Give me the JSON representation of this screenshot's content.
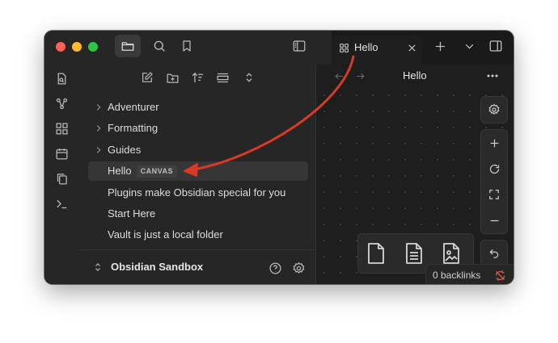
{
  "window": {
    "traffic_lights": {
      "close": "#ff5f57",
      "minimize": "#febc2e",
      "maximize": "#28c840"
    }
  },
  "tab": {
    "label": "Hello"
  },
  "view_header": {
    "title": "Hello"
  },
  "file_tree": {
    "folders": [
      {
        "label": "Adventurer"
      },
      {
        "label": "Formatting"
      },
      {
        "label": "Guides"
      }
    ],
    "active_file": {
      "label": "Hello",
      "badge": "CANVAS"
    },
    "files": [
      {
        "label": "Plugins make Obsidian special for you"
      },
      {
        "label": "Start Here"
      },
      {
        "label": "Vault is just a local folder"
      }
    ]
  },
  "vault": {
    "name": "Obsidian Sandbox"
  },
  "status_bar": {
    "backlinks": "0 backlinks"
  },
  "colors": {
    "annotation_arrow": "#d93a26",
    "accent": "#e05a4b"
  }
}
